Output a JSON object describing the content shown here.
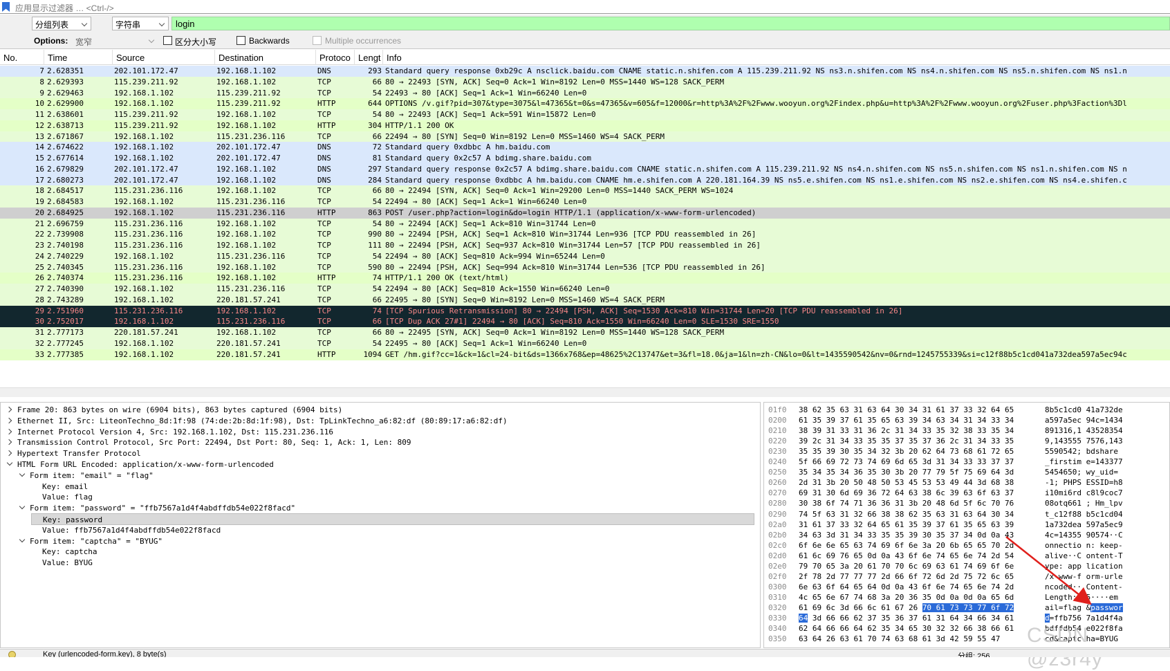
{
  "filter": {
    "placeholder": "应用显示过滤器 … <Ctrl-/>"
  },
  "find": {
    "search_in": "分组列表",
    "search_type": "字符串",
    "query": "login"
  },
  "options": {
    "label": "Options:",
    "charset": "宽窄",
    "case_sensitive": "区分大小写",
    "backwards": "Backwards",
    "multiple": "Multiple occurrences"
  },
  "columns": {
    "no": "No.",
    "time": "Time",
    "source": "Source",
    "destination": "Destination",
    "protocol": "Protoco",
    "length": "Lengt",
    "info": "Info"
  },
  "packets": [
    {
      "no": "7",
      "time": "2.628351",
      "src": "202.101.172.47",
      "dst": "192.168.1.102",
      "proto": "DNS",
      "len": "293",
      "info": "Standard query response 0xb29c A nsclick.baidu.com CNAME static.n.shifen.com A 115.239.211.92 NS ns3.n.shifen.com NS ns4.n.shifen.com NS ns5.n.shifen.com NS ns1.n",
      "cls": "dns"
    },
    {
      "no": "8",
      "time": "2.629393",
      "src": "115.239.211.92",
      "dst": "192.168.1.102",
      "proto": "TCP",
      "len": "66",
      "info": "80 → 22493 [SYN, ACK] Seq=0 Ack=1 Win=8192 Len=0 MSS=1440 WS=128 SACK_PERM",
      "cls": "tcp"
    },
    {
      "no": "9",
      "time": "2.629463",
      "src": "192.168.1.102",
      "dst": "115.239.211.92",
      "proto": "TCP",
      "len": "54",
      "info": "22493 → 80 [ACK] Seq=1 Ack=1 Win=66240 Len=0",
      "cls": "tcp"
    },
    {
      "no": "10",
      "time": "2.629900",
      "src": "192.168.1.102",
      "dst": "115.239.211.92",
      "proto": "HTTP",
      "len": "644",
      "info": "OPTIONS /v.gif?pid=307&type=3075&l=47365&t=0&s=47365&v=605&f=12000&r=http%3A%2F%2Fwww.wooyun.org%2Findex.php&u=http%3A%2F%2Fwww.wooyun.org%2Fuser.php%3Faction%3Dl",
      "cls": "http"
    },
    {
      "no": "11",
      "time": "2.638601",
      "src": "115.239.211.92",
      "dst": "192.168.1.102",
      "proto": "TCP",
      "len": "54",
      "info": "80 → 22493 [ACK] Seq=1 Ack=591 Win=15872 Len=0",
      "cls": "tcp"
    },
    {
      "no": "12",
      "time": "2.638713",
      "src": "115.239.211.92",
      "dst": "192.168.1.102",
      "proto": "HTTP",
      "len": "304",
      "info": "HTTP/1.1 200 OK",
      "cls": "http"
    },
    {
      "no": "13",
      "time": "2.671867",
      "src": "192.168.1.102",
      "dst": "115.231.236.116",
      "proto": "TCP",
      "len": "66",
      "info": "22494 → 80 [SYN] Seq=0 Win=8192 Len=0 MSS=1460 WS=4 SACK_PERM",
      "cls": "tcp"
    },
    {
      "no": "14",
      "time": "2.674622",
      "src": "192.168.1.102",
      "dst": "202.101.172.47",
      "proto": "DNS",
      "len": "72",
      "info": "Standard query 0xdbbc A hm.baidu.com",
      "cls": "dns"
    },
    {
      "no": "15",
      "time": "2.677614",
      "src": "192.168.1.102",
      "dst": "202.101.172.47",
      "proto": "DNS",
      "len": "81",
      "info": "Standard query 0x2c57 A bdimg.share.baidu.com",
      "cls": "dns"
    },
    {
      "no": "16",
      "time": "2.679829",
      "src": "202.101.172.47",
      "dst": "192.168.1.102",
      "proto": "DNS",
      "len": "297",
      "info": "Standard query response 0x2c57 A bdimg.share.baidu.com CNAME static.n.shifen.com A 115.239.211.92 NS ns4.n.shifen.com NS ns5.n.shifen.com NS ns1.n.shifen.com NS n",
      "cls": "dns"
    },
    {
      "no": "17",
      "time": "2.680273",
      "src": "202.101.172.47",
      "dst": "192.168.1.102",
      "proto": "DNS",
      "len": "284",
      "info": "Standard query response 0xdbbc A hm.baidu.com CNAME hm.e.shifen.com A 220.181.164.39 NS ns5.e.shifen.com NS ns1.e.shifen.com NS ns2.e.shifen.com NS ns4.e.shifen.c",
      "cls": "dns"
    },
    {
      "no": "18",
      "time": "2.684517",
      "src": "115.231.236.116",
      "dst": "192.168.1.102",
      "proto": "TCP",
      "len": "66",
      "info": "80 → 22494 [SYN, ACK] Seq=0 Ack=1 Win=29200 Len=0 MSS=1440 SACK_PERM WS=1024",
      "cls": "tcp"
    },
    {
      "no": "19",
      "time": "2.684583",
      "src": "192.168.1.102",
      "dst": "115.231.236.116",
      "proto": "TCP",
      "len": "54",
      "info": "22494 → 80 [ACK] Seq=1 Ack=1 Win=66240 Len=0",
      "cls": "tcp"
    },
    {
      "no": "20",
      "time": "2.684925",
      "src": "192.168.1.102",
      "dst": "115.231.236.116",
      "proto": "HTTP",
      "len": "863",
      "info": "POST /user.php?action=login&do=login HTTP/1.1  (application/x-www-form-urlencoded)",
      "cls": "selrow"
    },
    {
      "no": "21",
      "time": "2.696759",
      "src": "115.231.236.116",
      "dst": "192.168.1.102",
      "proto": "TCP",
      "len": "54",
      "info": "80 → 22494 [ACK] Seq=1 Ack=810 Win=31744 Len=0",
      "cls": "tcp"
    },
    {
      "no": "22",
      "time": "2.739908",
      "src": "115.231.236.116",
      "dst": "192.168.1.102",
      "proto": "TCP",
      "len": "990",
      "info": "80 → 22494 [PSH, ACK] Seq=1 Ack=810 Win=31744 Len=936 [TCP PDU reassembled in 26]",
      "cls": "tcp"
    },
    {
      "no": "23",
      "time": "2.740198",
      "src": "115.231.236.116",
      "dst": "192.168.1.102",
      "proto": "TCP",
      "len": "111",
      "info": "80 → 22494 [PSH, ACK] Seq=937 Ack=810 Win=31744 Len=57 [TCP PDU reassembled in 26]",
      "cls": "tcp"
    },
    {
      "no": "24",
      "time": "2.740229",
      "src": "192.168.1.102",
      "dst": "115.231.236.116",
      "proto": "TCP",
      "len": "54",
      "info": "22494 → 80 [ACK] Seq=810 Ack=994 Win=65244 Len=0",
      "cls": "tcp"
    },
    {
      "no": "25",
      "time": "2.740345",
      "src": "115.231.236.116",
      "dst": "192.168.1.102",
      "proto": "TCP",
      "len": "590",
      "info": "80 → 22494 [PSH, ACK] Seq=994 Ack=810 Win=31744 Len=536 [TCP PDU reassembled in 26]",
      "cls": "tcp"
    },
    {
      "no": "26",
      "time": "2.740374",
      "src": "115.231.236.116",
      "dst": "192.168.1.102",
      "proto": "HTTP",
      "len": "74",
      "info": "HTTP/1.1 200 OK  (text/html)",
      "cls": "http"
    },
    {
      "no": "27",
      "time": "2.740390",
      "src": "192.168.1.102",
      "dst": "115.231.236.116",
      "proto": "TCP",
      "len": "54",
      "info": "22494 → 80 [ACK] Seq=810 Ack=1550 Win=66240 Len=0",
      "cls": "tcp"
    },
    {
      "no": "28",
      "time": "2.743289",
      "src": "192.168.1.102",
      "dst": "220.181.57.241",
      "proto": "TCP",
      "len": "66",
      "info": "22495 → 80 [SYN] Seq=0 Win=8192 Len=0 MSS=1460 WS=4 SACK_PERM",
      "cls": "tcp"
    },
    {
      "no": "29",
      "time": "2.751960",
      "src": "115.231.236.116",
      "dst": "192.168.1.102",
      "proto": "TCP",
      "len": "74",
      "info": "[TCP Spurious Retransmission] 80 → 22494 [PSH, ACK] Seq=1530 Ack=810 Win=31744 Len=20 [TCP PDU reassembled in 26]",
      "cls": "bad"
    },
    {
      "no": "30",
      "time": "2.752017",
      "src": "192.168.1.102",
      "dst": "115.231.236.116",
      "proto": "TCP",
      "len": "66",
      "info": "[TCP Dup ACK 27#1] 22494 → 80 [ACK] Seq=810 Ack=1550 Win=66240 Len=0 SLE=1530 SRE=1550",
      "cls": "bad"
    },
    {
      "no": "31",
      "time": "2.777173",
      "src": "220.181.57.241",
      "dst": "192.168.1.102",
      "proto": "TCP",
      "len": "66",
      "info": "80 → 22495 [SYN, ACK] Seq=0 Ack=1 Win=8192 Len=0 MSS=1440 WS=128 SACK_PERM",
      "cls": "tcp"
    },
    {
      "no": "32",
      "time": "2.777245",
      "src": "192.168.1.102",
      "dst": "220.181.57.241",
      "proto": "TCP",
      "len": "54",
      "info": "22495 → 80 [ACK] Seq=1 Ack=1 Win=66240 Len=0",
      "cls": "tcp"
    },
    {
      "no": "33",
      "time": "2.777385",
      "src": "192.168.1.102",
      "dst": "220.181.57.241",
      "proto": "HTTP",
      "len": "1094",
      "info": "GET /hm.gif?cc=1&ck=1&cl=24-bit&ds=1366x768&ep=48625%2C13747&et=3&fl=18.0&ja=1&ln=zh-CN&lo=0&lt=1435590542&nv=0&rnd=1245755339&si=c12f88b5c1cd041a732dea597a5ec94c",
      "cls": "http"
    }
  ],
  "details": [
    {
      "text": "Frame 20: 863 bytes on wire (6904 bits), 863 bytes captured (6904 bits)",
      "indent": 0,
      "exp": "r"
    },
    {
      "text": "Ethernet II, Src: LiteonTechno_8d:1f:98 (74:de:2b:8d:1f:98), Dst: TpLinkTechno_a6:82:df (80:89:17:a6:82:df)",
      "indent": 0,
      "exp": "r"
    },
    {
      "text": "Internet Protocol Version 4, Src: 192.168.1.102, Dst: 115.231.236.116",
      "indent": 0,
      "exp": "r"
    },
    {
      "text": "Transmission Control Protocol, Src Port: 22494, Dst Port: 80, Seq: 1, Ack: 1, Len: 809",
      "indent": 0,
      "exp": "r"
    },
    {
      "text": "Hypertext Transfer Protocol",
      "indent": 0,
      "exp": "r"
    },
    {
      "text": "HTML Form URL Encoded: application/x-www-form-urlencoded",
      "indent": 0,
      "exp": "d"
    },
    {
      "text": "Form item: \"email\" = \"flag\"",
      "indent": 1,
      "exp": "d"
    },
    {
      "text": "Key: email",
      "indent": 2,
      "exp": ""
    },
    {
      "text": "Value: flag",
      "indent": 2,
      "exp": ""
    },
    {
      "text": "Form item: \"password\" = \"ffb7567a1d4f4abdffdb54e022f8facd\"",
      "indent": 1,
      "exp": "d"
    },
    {
      "text": "Key: password",
      "indent": 2,
      "exp": "",
      "sel": true
    },
    {
      "text": "Value: ffb7567a1d4f4abdffdb54e022f8facd",
      "indent": 2,
      "exp": ""
    },
    {
      "text": "Form item: \"captcha\" = \"BYUG\"",
      "indent": 1,
      "exp": "d"
    },
    {
      "text": "Key: captcha",
      "indent": 2,
      "exp": ""
    },
    {
      "text": "Value: BYUG",
      "indent": 2,
      "exp": ""
    }
  ],
  "bytes": [
    {
      "off": "01f0",
      "hex": "38 62 35 63 31 63 64 30  34 31 61 37 33 32 64 65",
      "asc": "8b5c1cd0 41a732de"
    },
    {
      "off": "0200",
      "hex": "61 35 39 37 61 35 65 63  39 34 63 34 31 34 33 34",
      "asc": "a597a5ec 94c=1434"
    },
    {
      "off": "0210",
      "hex": "38 39 31 33 31 36 2c 31  34 33 35 32 38 33 35 34",
      "asc": "891316,1 43528354"
    },
    {
      "off": "0220",
      "hex": "39 2c 31 34 33 35 35 37  35 37 36 2c 31 34 33 35",
      "asc": "9,143555 7576,143"
    },
    {
      "off": "0230",
      "hex": "35 35 39 30 35 34 32 3b  20 62 64 73 68 61 72 65",
      "asc": "5590542;  bdshare"
    },
    {
      "off": "0240",
      "hex": "5f 66 69 72 73 74 69 6d  65 3d 31 34 33 33 37 37",
      "asc": "_firstim e=143377"
    },
    {
      "off": "0250",
      "hex": "35 34 35 34 36 35 30 3b  20 77 79 5f 75 69 64 3d",
      "asc": "5454650;  wy_uid="
    },
    {
      "off": "0260",
      "hex": "2d 31 3b 20 50 48 50 53  45 53 53 49 44 3d 68 38",
      "asc": "-1; PHPS ESSID=h8"
    },
    {
      "off": "0270",
      "hex": "69 31 30 6d 69 36 72 64  63 38 6c 39 63 6f 63 37",
      "asc": "i10mi6rd c8l9coc7"
    },
    {
      "off": "0280",
      "hex": "30 38 6f 74 71 36 36 31  3b 20 48 6d 5f 6c 70 76",
      "asc": "08otq661 ; Hm_lpv"
    },
    {
      "off": "0290",
      "hex": "74 5f 63 31 32 66 38 38  62 35 63 31 63 64 30 34",
      "asc": "t_c12f88 b5c1cd04"
    },
    {
      "off": "02a0",
      "hex": "31 61 37 33 32 64 65 61  35 39 37 61 35 65 63 39",
      "asc": "1a732dea 597a5ec9"
    },
    {
      "off": "02b0",
      "hex": "34 63 3d 31 34 33 35 35  39 30 35 37 34 0d 0a 43",
      "asc": "4c=14355 90574··C"
    },
    {
      "off": "02c0",
      "hex": "6f 6e 6e 65 63 74 69 6f  6e 3a 20 6b 65 65 70 2d",
      "asc": "onnectio n: keep-"
    },
    {
      "off": "02d0",
      "hex": "61 6c 69 76 65 0d 0a 43  6f 6e 74 65 6e 74 2d 54",
      "asc": "alive··C ontent-T"
    },
    {
      "off": "02e0",
      "hex": "79 70 65 3a 20 61 70 70  6c 69 63 61 74 69 6f 6e",
      "asc": "ype: app lication"
    },
    {
      "off": "02f0",
      "hex": "2f 78 2d 77 77 77 2d 66  6f 72 6d 2d 75 72 6c 65",
      "asc": "/x-www-f orm-urle"
    },
    {
      "off": "0300",
      "hex": "6e 63 6f 64 65 64 0d 0a  43 6f 6e 74 65 6e 74 2d",
      "asc": "ncoded·· Content-"
    },
    {
      "off": "0310",
      "hex": "4c 65 6e 67 74 68 3a 20  36 35 0d 0a 0d 0a 65 6d",
      "asc": "Length:  65····em"
    },
    {
      "off": "0320",
      "hex1": "61 69 6c 3d 66 6c 61 67  26 ",
      "hexh": "70 61 73 73 77 6f 72",
      "asc1": "ail=flag &",
      "asch": "passwor"
    },
    {
      "off": "0330",
      "hexh2": "64",
      "hex2": " 3d 66 66 62 37 35 36  37 61 31 64 34 66 34 61",
      "asch2": "d",
      "asc2": "=ffb756 7a1d4f4a"
    },
    {
      "off": "0340",
      "hex": "62 64 66 66 64 62 35 34  65 30 32 32 66 38 66 61",
      "asc": "bdffdb54 e022f8fa"
    },
    {
      "off": "0350",
      "hex": "63 64 26 63 61 70 74 63  68 61 3d 42 59 55 47",
      "asc": "cd&captc ha=BYUG"
    }
  ],
  "status": {
    "left": "Key (urlencoded-form.key), 8 byte(s)",
    "right": "分组: 256"
  },
  "watermark": "CSDN @z3r4y"
}
